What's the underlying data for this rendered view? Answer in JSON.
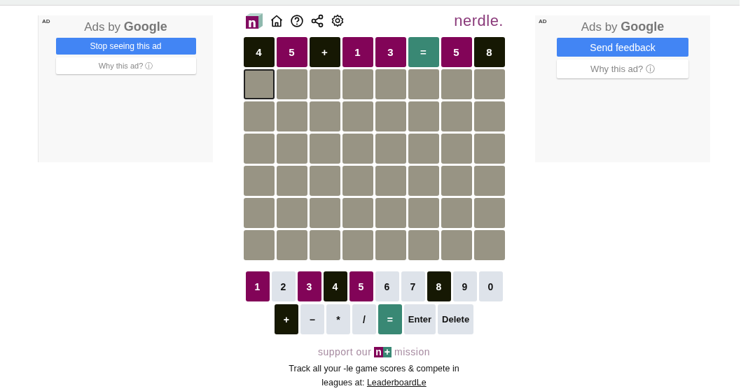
{
  "ads": [
    {
      "label": "AD",
      "heading_plain": "Ads by ",
      "heading_brand": "Google",
      "primary_button": "Stop seeing this ad",
      "secondary_button": "Why this ad?",
      "info_icon": "ⓘ"
    },
    {
      "label": "AD",
      "heading_plain": "Ads by ",
      "heading_brand": "Google",
      "primary_button": "Send feedback",
      "secondary_button": "Why this ad?",
      "info_icon": "ⓘ"
    }
  ],
  "header": {
    "logo_letter": "n",
    "wordmark": "nerdle."
  },
  "board": {
    "rows": [
      {
        "tiles": [
          {
            "text": "4",
            "kind": "absent",
            "selected": false
          },
          {
            "text": "5",
            "kind": "present",
            "selected": false
          },
          {
            "text": "+",
            "kind": "absent",
            "selected": false
          },
          {
            "text": "1",
            "kind": "present",
            "selected": false
          },
          {
            "text": "3",
            "kind": "present",
            "selected": false
          },
          {
            "text": "=",
            "kind": "correct",
            "selected": false
          },
          {
            "text": "5",
            "kind": "present",
            "selected": false
          },
          {
            "text": "8",
            "kind": "absent",
            "selected": false
          }
        ]
      },
      {
        "tiles": [
          {
            "kind": "empty",
            "selected": true
          },
          {
            "kind": "empty",
            "selected": false
          },
          {
            "kind": "empty",
            "selected": false
          },
          {
            "kind": "empty",
            "selected": false
          },
          {
            "kind": "empty",
            "selected": false
          },
          {
            "kind": "empty",
            "selected": false
          },
          {
            "kind": "empty",
            "selected": false
          },
          {
            "kind": "empty",
            "selected": false
          }
        ]
      },
      {
        "tiles": [
          {
            "kind": "empty",
            "selected": false
          },
          {
            "kind": "empty",
            "selected": false
          },
          {
            "kind": "empty",
            "selected": false
          },
          {
            "kind": "empty",
            "selected": false
          },
          {
            "kind": "empty",
            "selected": false
          },
          {
            "kind": "empty",
            "selected": false
          },
          {
            "kind": "empty",
            "selected": false
          },
          {
            "kind": "empty",
            "selected": false
          }
        ]
      },
      {
        "tiles": [
          {
            "kind": "empty",
            "selected": false
          },
          {
            "kind": "empty",
            "selected": false
          },
          {
            "kind": "empty",
            "selected": false
          },
          {
            "kind": "empty",
            "selected": false
          },
          {
            "kind": "empty",
            "selected": false
          },
          {
            "kind": "empty",
            "selected": false
          },
          {
            "kind": "empty",
            "selected": false
          },
          {
            "kind": "empty",
            "selected": false
          }
        ]
      },
      {
        "tiles": [
          {
            "kind": "empty",
            "selected": false
          },
          {
            "kind": "empty",
            "selected": false
          },
          {
            "kind": "empty",
            "selected": false
          },
          {
            "kind": "empty",
            "selected": false
          },
          {
            "kind": "empty",
            "selected": false
          },
          {
            "kind": "empty",
            "selected": false
          },
          {
            "kind": "empty",
            "selected": false
          },
          {
            "kind": "empty",
            "selected": false
          }
        ]
      },
      {
        "tiles": [
          {
            "kind": "empty",
            "selected": false
          },
          {
            "kind": "empty",
            "selected": false
          },
          {
            "kind": "empty",
            "selected": false
          },
          {
            "kind": "empty",
            "selected": false
          },
          {
            "kind": "empty",
            "selected": false
          },
          {
            "kind": "empty",
            "selected": false
          },
          {
            "kind": "empty",
            "selected": false
          },
          {
            "kind": "empty",
            "selected": false
          }
        ]
      },
      {
        "tiles": [
          {
            "kind": "empty",
            "selected": false
          },
          {
            "kind": "empty",
            "selected": false
          },
          {
            "kind": "empty",
            "selected": false
          },
          {
            "kind": "empty",
            "selected": false
          },
          {
            "kind": "empty",
            "selected": false
          },
          {
            "kind": "empty",
            "selected": false
          },
          {
            "kind": "empty",
            "selected": false
          },
          {
            "kind": "empty",
            "selected": false
          }
        ]
      }
    ]
  },
  "keyboard": {
    "rows": [
      {
        "keys": [
          {
            "label": "1",
            "kind": "present"
          },
          {
            "label": "2",
            "kind": "unused"
          },
          {
            "label": "3",
            "kind": "present"
          },
          {
            "label": "4",
            "kind": "absent"
          },
          {
            "label": "5",
            "kind": "present"
          },
          {
            "label": "6",
            "kind": "unused"
          },
          {
            "label": "7",
            "kind": "unused"
          },
          {
            "label": "8",
            "kind": "absent"
          },
          {
            "label": "9",
            "kind": "unused"
          },
          {
            "label": "0",
            "kind": "unused"
          }
        ]
      },
      {
        "keys": [
          {
            "label": "+",
            "kind": "absent"
          },
          {
            "label": "−",
            "kind": "unused"
          },
          {
            "label": "*",
            "kind": "unused"
          },
          {
            "label": "/",
            "kind": "unused"
          },
          {
            "label": "=",
            "kind": "correct"
          },
          {
            "label": "Enter",
            "kind": "unused"
          },
          {
            "label": "Delete",
            "kind": "unused"
          }
        ]
      }
    ]
  },
  "footer": {
    "support_before": "support our",
    "badge_letter": "n",
    "badge_plus": "+",
    "support_after": "mission",
    "track_text": "Track all your -le game scores & compete in leagues at:",
    "link": "LeaderboardLe"
  }
}
